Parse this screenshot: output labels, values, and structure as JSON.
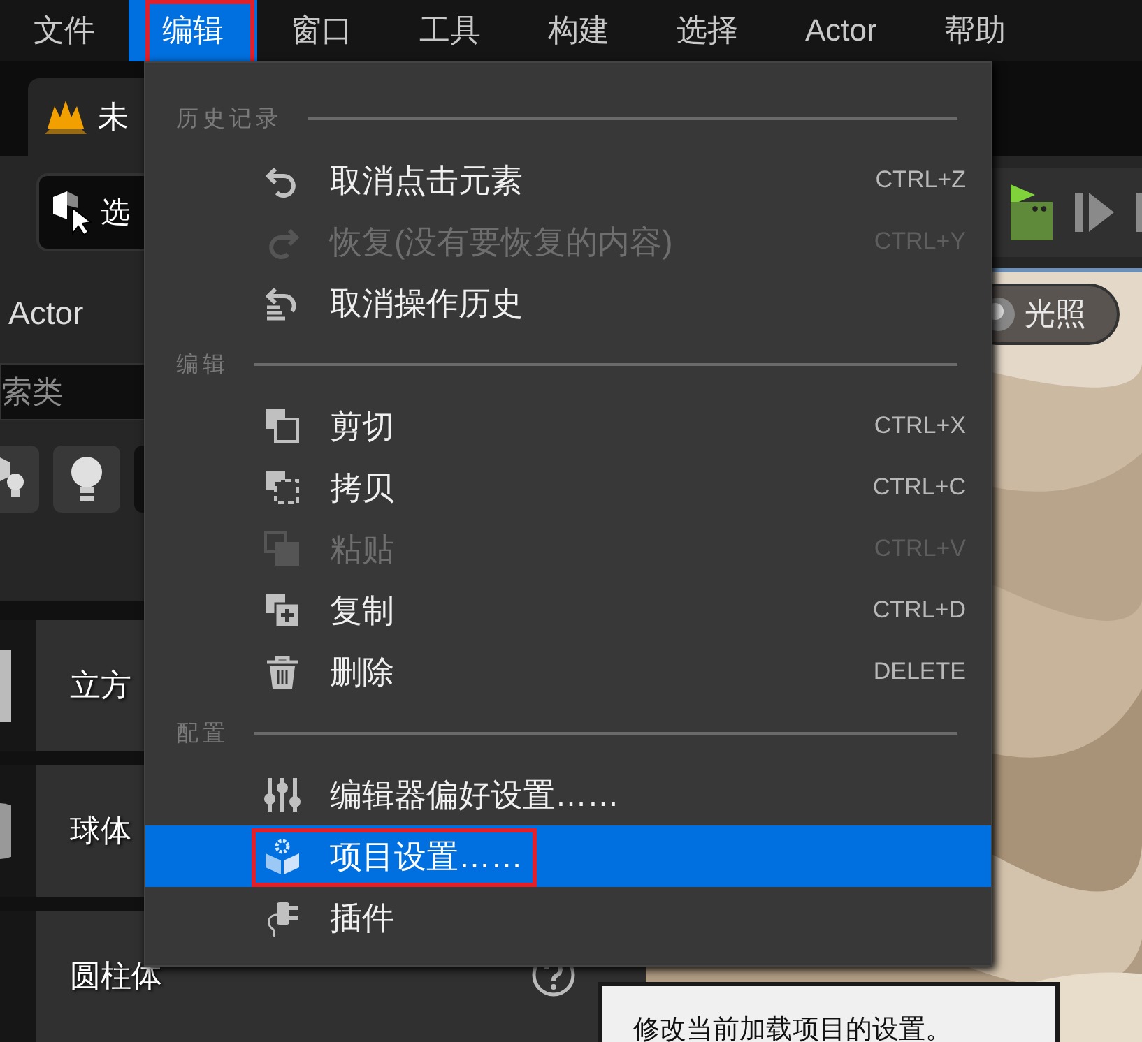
{
  "menubar": [
    {
      "label": "文件",
      "selected": false,
      "highlighted": false
    },
    {
      "label": "编辑",
      "selected": true,
      "highlighted": true
    },
    {
      "label": "窗口",
      "selected": false,
      "highlighted": false
    },
    {
      "label": "工具",
      "selected": false,
      "highlighted": false
    },
    {
      "label": "构建",
      "selected": false,
      "highlighted": false
    },
    {
      "label": "选择",
      "selected": false,
      "highlighted": false
    },
    {
      "label": "Actor",
      "selected": false,
      "highlighted": false
    },
    {
      "label": "帮助",
      "selected": false,
      "highlighted": false
    }
  ],
  "editor_tab": {
    "label": "未"
  },
  "toolbar": {
    "mode_button": "选"
  },
  "place_panel": {
    "title": "Actor",
    "search": {
      "placeholder": "索类"
    },
    "items": [
      {
        "label": "立方"
      },
      {
        "label": "球体"
      },
      {
        "label": "圆柱体"
      }
    ]
  },
  "viewport": {
    "lighting_button": "光照"
  },
  "edit_menu": {
    "sections": [
      {
        "header": "历史记录",
        "items": [
          {
            "kind": "undo",
            "label": "取消点击元素",
            "shortcut": "CTRL+Z",
            "disabled": false,
            "selected": false,
            "highlighted": false
          },
          {
            "kind": "redo",
            "label": "恢复(没有要恢复的内容)",
            "shortcut": "CTRL+Y",
            "disabled": true,
            "selected": false,
            "highlighted": false
          },
          {
            "kind": "history",
            "label": "取消操作历史",
            "disabled": false,
            "selected": false,
            "highlighted": false
          }
        ]
      },
      {
        "header": "编辑",
        "items": [
          {
            "kind": "cut",
            "label": "剪切",
            "shortcut": "CTRL+X",
            "disabled": false,
            "selected": false,
            "highlighted": false
          },
          {
            "kind": "copy",
            "label": "拷贝",
            "shortcut": "CTRL+C",
            "disabled": false,
            "selected": false,
            "highlighted": false
          },
          {
            "kind": "paste",
            "label": "粘贴",
            "shortcut": "CTRL+V",
            "disabled": true,
            "selected": false,
            "highlighted": false
          },
          {
            "kind": "duplicate",
            "label": "复制",
            "shortcut": "CTRL+D",
            "disabled": false,
            "selected": false,
            "highlighted": false
          },
          {
            "kind": "delete",
            "label": "删除",
            "shortcut": "DELETE",
            "disabled": false,
            "selected": false,
            "highlighted": false
          }
        ]
      },
      {
        "header": "配置",
        "items": [
          {
            "kind": "preferences",
            "label": "编辑器偏好设置……",
            "disabled": false,
            "selected": false,
            "highlighted": false
          },
          {
            "kind": "project",
            "label": "项目设置……",
            "disabled": false,
            "selected": true,
            "highlighted": true
          },
          {
            "kind": "plugin",
            "label": "插件",
            "disabled": false,
            "selected": false,
            "highlighted": false
          }
        ]
      }
    ]
  },
  "tooltip": {
    "text": "修改当前加载项目的设置。"
  }
}
